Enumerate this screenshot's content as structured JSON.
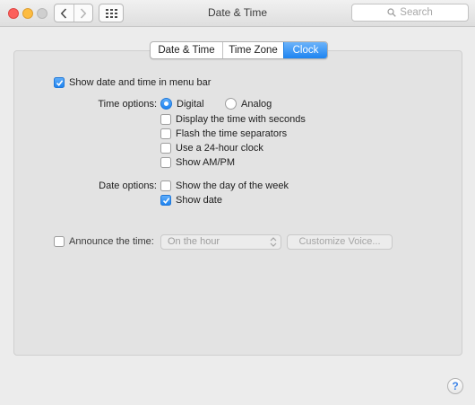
{
  "window": {
    "title": "Date & Time",
    "search_placeholder": "Search"
  },
  "tabs": [
    {
      "label": "Date & Time",
      "selected": false
    },
    {
      "label": "Time Zone",
      "selected": false
    },
    {
      "label": "Clock",
      "selected": true
    }
  ],
  "clock": {
    "show_in_menu_bar": {
      "label": "Show date and time in menu bar",
      "checked": true
    },
    "time_options": {
      "label": "Time options:",
      "digital": {
        "label": "Digital",
        "selected": true
      },
      "analog": {
        "label": "Analog",
        "selected": false
      },
      "checkboxes": [
        {
          "label": "Display the time with seconds",
          "checked": false
        },
        {
          "label": "Flash the time separators",
          "checked": false
        },
        {
          "label": "Use a 24-hour clock",
          "checked": false
        },
        {
          "label": "Show AM/PM",
          "checked": false
        }
      ]
    },
    "date_options": {
      "label": "Date options:",
      "checkboxes": [
        {
          "label": "Show the day of the week",
          "checked": false
        },
        {
          "label": "Show date",
          "checked": true
        }
      ]
    },
    "announce": {
      "label": "Announce the time:",
      "checked": false,
      "interval_value": "On the hour",
      "customize_voice_label": "Customize Voice..."
    }
  },
  "help": {
    "glyph": "?"
  },
  "colors": {
    "accent": "#1e83f0",
    "close": "#fc605c",
    "minimize": "#fdbc40"
  }
}
